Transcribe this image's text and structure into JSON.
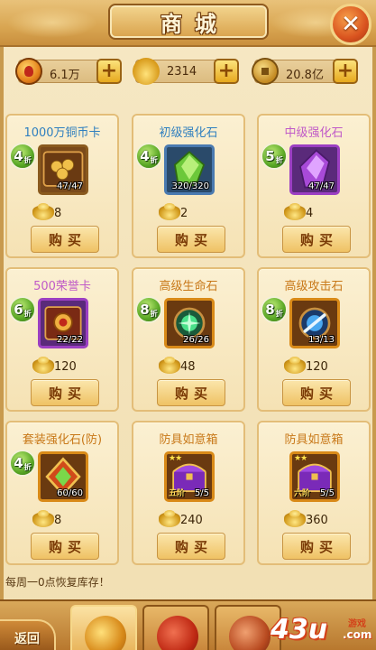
{
  "header": {
    "title": "商城",
    "close_label": "✕"
  },
  "currency": [
    {
      "name": "honor",
      "icon": "honor-medal-icon",
      "value": "6.1万",
      "plus": "+"
    },
    {
      "name": "gold-ingot",
      "icon": "gold-ingot-icon",
      "value": "2314",
      "plus": "+"
    },
    {
      "name": "copper-coin",
      "icon": "copper-coin-icon",
      "value": "20.8亿",
      "plus": "+"
    }
  ],
  "items": [
    {
      "name": "1000万铜币卡",
      "discount": "4",
      "discount_suffix": "折",
      "stock": "47/47",
      "price": "8",
      "buy": "购买",
      "name_color": "blue"
    },
    {
      "name": "初级强化石",
      "discount": "4",
      "discount_suffix": "折",
      "stock": "320/320",
      "price": "2",
      "buy": "购买",
      "name_color": "blue"
    },
    {
      "name": "中级强化石",
      "discount": "5",
      "discount_suffix": "折",
      "stock": "47/47",
      "price": "4",
      "buy": "购买",
      "name_color": "purple"
    },
    {
      "name": "500荣誉卡",
      "discount": "6",
      "discount_suffix": "折",
      "stock": "22/22",
      "price": "120",
      "buy": "购买",
      "name_color": "purple"
    },
    {
      "name": "高级生命石",
      "discount": "8",
      "discount_suffix": "折",
      "stock": "26/26",
      "price": "48",
      "buy": "购买",
      "name_color": "orange"
    },
    {
      "name": "高级攻击石",
      "discount": "8",
      "discount_suffix": "折",
      "stock": "13/13",
      "price": "120",
      "buy": "购买",
      "name_color": "orange"
    },
    {
      "name": "套装强化石(防)",
      "discount": "4",
      "discount_suffix": "折",
      "stock": "60/60",
      "price": "8",
      "buy": "购买",
      "name_color": "orange"
    },
    {
      "name": "防具如意箱",
      "discount": "",
      "discount_suffix": "",
      "stock": "5/5",
      "tier": "五阶",
      "price": "240",
      "buy": "购买",
      "name_color": "orange"
    },
    {
      "name": "防具如意箱",
      "discount": "",
      "discount_suffix": "",
      "stock": "5/5",
      "tier": "六阶",
      "price": "360",
      "buy": "购买",
      "name_color": "orange"
    }
  ],
  "footer": {
    "note": "每周一0点恢复库存！",
    "back_label": "返回",
    "logo_main": "43u",
    "logo_game": "游戏",
    "logo_com": ".com"
  },
  "colors": {
    "accent": "#d9a652",
    "buy_text": "#7a3a06",
    "name_blue": "#2f7fbf",
    "name_purple": "#c05ac8",
    "name_orange": "#c87818"
  }
}
